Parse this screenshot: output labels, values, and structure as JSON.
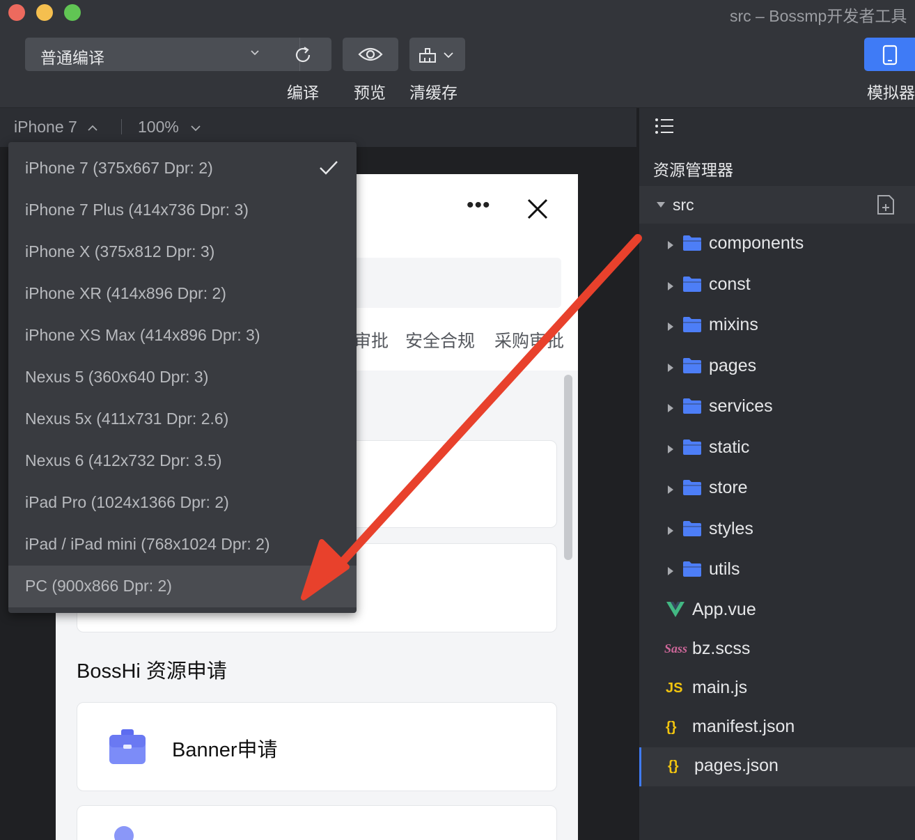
{
  "window": {
    "title": "src – Bossmp开发者工具"
  },
  "toolbar": {
    "compile_mode": "普通编译",
    "compile_label": "编译",
    "preview_label": "预览",
    "clear_cache_label": "清缓存",
    "simulator_label": "模拟器"
  },
  "device_bar": {
    "device": "iPhone 7",
    "zoom": "100%"
  },
  "device_menu": {
    "items": [
      "iPhone 7 (375x667 Dpr: 2)",
      "iPhone 7 Plus (414x736 Dpr: 3)",
      "iPhone X (375x812 Dpr: 3)",
      "iPhone XR (414x896 Dpr: 2)",
      "iPhone XS Max (414x896 Dpr: 3)",
      "Nexus 5 (360x640 Dpr: 3)",
      "Nexus 5x (411x731 Dpr: 2.6)",
      "Nexus 6 (412x732 Dpr: 3.5)",
      "iPad Pro (1024x1366 Dpr: 2)",
      "iPad / iPad mini (768x1024 Dpr: 2)",
      "PC (900x866 Dpr: 2)"
    ],
    "checked_index": 0,
    "highlighted_index": 10
  },
  "phone": {
    "tabs": [
      "审批",
      "安全合规",
      "采购审批"
    ],
    "section_title": "BossHi 资源申请",
    "card_label": "Banner申请"
  },
  "explorer": {
    "title": "资源管理器",
    "root": "src",
    "folders": [
      "components",
      "const",
      "mixins",
      "pages",
      "services",
      "static",
      "store",
      "styles",
      "utils"
    ],
    "files": [
      {
        "icon": "V",
        "name": "App.vue"
      },
      {
        "icon": "Sass",
        "name": "bz.scss"
      },
      {
        "icon": "JS",
        "name": "main.js"
      },
      {
        "icon": "{}",
        "name": "manifest.json"
      },
      {
        "icon": "{}",
        "name": "pages.json"
      }
    ],
    "active_file": "pages.json"
  },
  "colors": {
    "accent": "#3f7bf6",
    "annotation_arrow": "#e8412c",
    "folder": "#4d7ef7"
  }
}
